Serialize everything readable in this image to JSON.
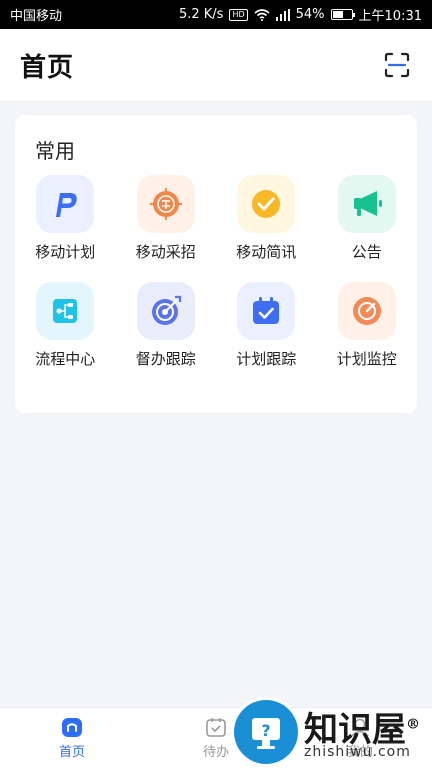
{
  "status_bar": {
    "carrier": "中国移动",
    "speed": "5.2 K/s",
    "hd": "HD",
    "battery": "54%",
    "battery_level": 0.54,
    "time": "上午10:31"
  },
  "header": {
    "title": "首页",
    "scan_icon": "scan-icon"
  },
  "section": {
    "title": "常用",
    "items": [
      {
        "label": "移动计划",
        "icon": "plan-p-icon",
        "bg": "#eaf0ff",
        "color": "#3d6cf5"
      },
      {
        "label": "移动采招",
        "icon": "procurement-icon",
        "bg": "#fff0e8",
        "color": "#f2874a"
      },
      {
        "label": "移动简讯",
        "icon": "message-check-icon",
        "bg": "#fff7e0",
        "color": "#f7b92a"
      },
      {
        "label": "公告",
        "icon": "megaphone-icon",
        "bg": "#e3f8f1",
        "color": "#19c191"
      },
      {
        "label": "流程中心",
        "icon": "flow-icon",
        "bg": "#e2f6fb",
        "color": "#1ec3e6"
      },
      {
        "label": "督办跟踪",
        "icon": "target-icon",
        "bg": "#e9edfb",
        "color": "#5b73e8"
      },
      {
        "label": "计划跟踪",
        "icon": "calendar-check-icon",
        "bg": "#eaf0ff",
        "color": "#3f6ef0"
      },
      {
        "label": "计划监控",
        "icon": "monitor-target-icon",
        "bg": "#fff0e8",
        "color": "#f28a55"
      }
    ]
  },
  "bottom_nav": {
    "items": [
      {
        "label": "首页",
        "icon": "home-icon",
        "active": true
      },
      {
        "label": "待办",
        "icon": "todo-icon",
        "active": false
      },
      {
        "label": "我的",
        "icon": "profile-icon",
        "active": false
      }
    ]
  },
  "watermark": {
    "text": "知识屋",
    "reg": "®",
    "url": "zhishiwu.com"
  },
  "colors": {
    "accent": "#2f6df6",
    "background": "#f4f5f8"
  }
}
